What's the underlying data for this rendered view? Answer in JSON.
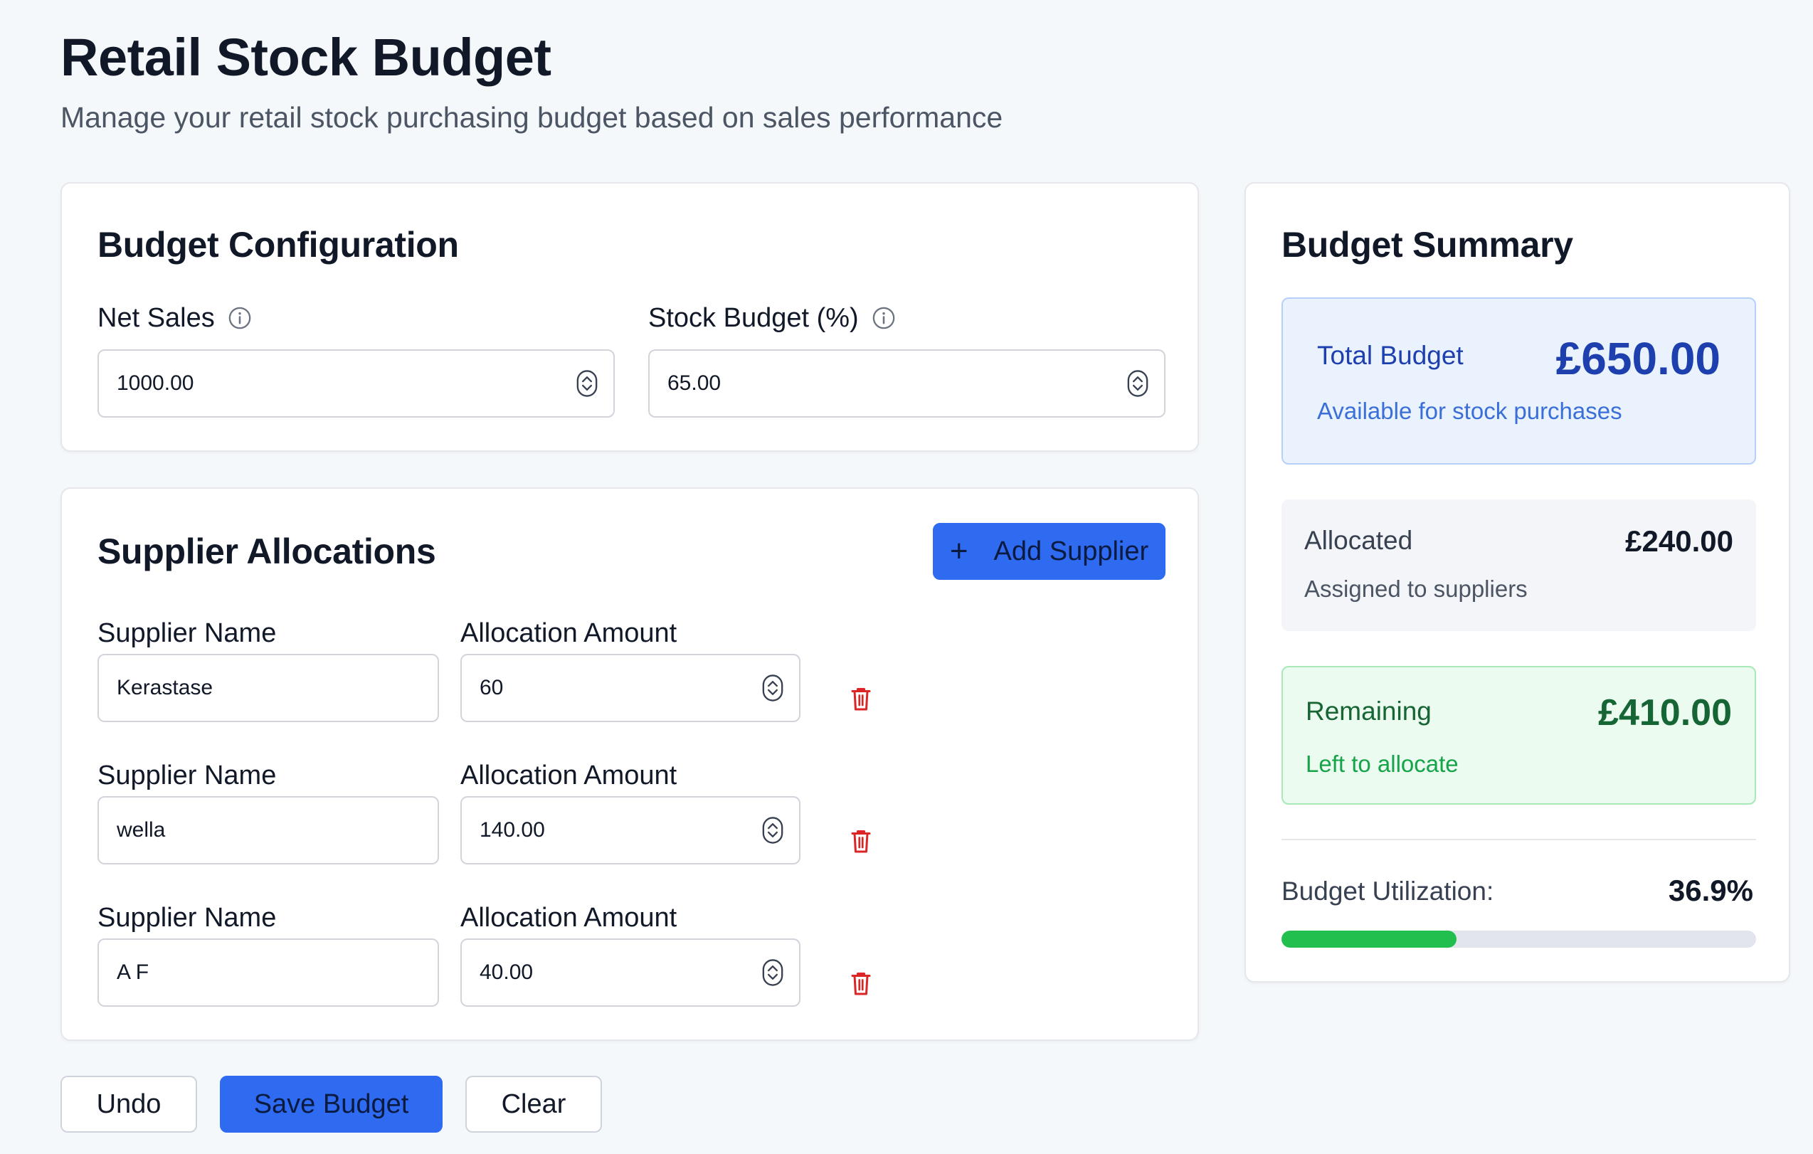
{
  "header": {
    "title": "Retail Stock Budget",
    "subtitle": "Manage your retail stock purchasing budget based on sales performance"
  },
  "config": {
    "title": "Budget Configuration",
    "net_sales": {
      "label": "Net Sales",
      "value": "1000.00"
    },
    "stock_budget": {
      "label": "Stock Budget (%)",
      "value": "65.00"
    },
    "icons": {
      "info": "info-circle-icon",
      "spinner": "number-spinner-icon"
    }
  },
  "allocations": {
    "title": "Supplier Allocations",
    "add_button": "Add Supplier",
    "name_label": "Supplier Name",
    "amount_label": "Allocation Amount",
    "rows": [
      {
        "name": "Kerastase",
        "amount": "60"
      },
      {
        "name": "wella",
        "amount": "140.00"
      },
      {
        "name": "A F",
        "amount": "40.00"
      }
    ],
    "icons": {
      "delete": "trash-icon",
      "add": "plus-icon"
    }
  },
  "summary": {
    "title": "Budget Summary",
    "total": {
      "label": "Total Budget",
      "amount": "£650.00",
      "sub": "Available for stock purchases"
    },
    "allocated": {
      "label": "Allocated",
      "amount": "£240.00",
      "sub": "Assigned to suppliers"
    },
    "remaining": {
      "label": "Remaining",
      "amount": "£410.00",
      "sub": "Left to allocate"
    },
    "utilization": {
      "label": "Budget Utilization:",
      "value": "36.9%",
      "fraction": 0.369
    }
  },
  "actions": {
    "undo": "Undo",
    "save": "Save Budget",
    "clear": "Clear"
  },
  "colors": {
    "primary": "#2f6bf0",
    "total_text": "#1e40af",
    "remaining_text": "#166534",
    "progress": "#22bf4e",
    "danger": "#dc2626"
  }
}
